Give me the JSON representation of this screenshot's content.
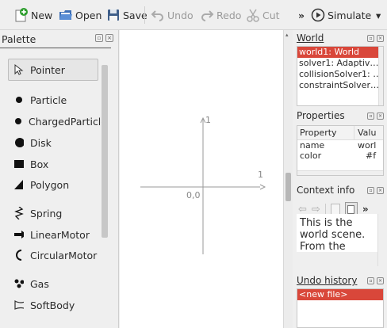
{
  "toolbar": {
    "new_label": "New",
    "open_label": "Open",
    "save_label": "Save",
    "undo_label": "Undo",
    "redo_label": "Redo",
    "cut_label": "Cut",
    "more_label": "»",
    "simulate_label": "Simulate",
    "dropdown_label": "▾"
  },
  "palette": {
    "title": "Palette",
    "items": [
      {
        "label": "Pointer",
        "icon": "pointer-arrow-icon"
      },
      {
        "label": "Particle",
        "icon": "small-dot-icon"
      },
      {
        "label": "ChargedParticle",
        "icon": "small-dot-icon"
      },
      {
        "label": "Disk",
        "icon": "disk-icon"
      },
      {
        "label": "Box",
        "icon": "box-icon"
      },
      {
        "label": "Polygon",
        "icon": "polygon-icon"
      },
      {
        "label": "Spring",
        "icon": "spring-icon"
      },
      {
        "label": "LinearMotor",
        "icon": "linear-motor-icon"
      },
      {
        "label": "CircularMotor",
        "icon": "circular-motor-icon"
      },
      {
        "label": "Gas",
        "icon": "gas-icon"
      },
      {
        "label": "SoftBody",
        "icon": "softbody-icon"
      }
    ]
  },
  "canvas": {
    "axis_y_label": "1",
    "axis_x_label": "1",
    "origin_label": "0,0"
  },
  "world": {
    "title": "World",
    "items": [
      "world1: World",
      "solver1: Adaptiv…",
      "collisionSolver1: …",
      "constraintSolver…"
    ],
    "selected_index": 0
  },
  "properties": {
    "title": "Properties",
    "col_property": "Property",
    "col_value": "Valu",
    "rows": [
      {
        "name": "name",
        "value": "worl"
      },
      {
        "name": "color",
        "value": "#f"
      }
    ]
  },
  "context_info": {
    "title": "Context info",
    "text_lines": [
      "This is the",
      "world scene.",
      "From the"
    ],
    "more_label": "»"
  },
  "undo_history": {
    "title": "Undo history",
    "items": [
      "<new file>"
    ]
  },
  "colors": {
    "selection": "#d9473a",
    "new_icon_green": "#2e9e2e",
    "folder_blue": "#3d6fb6"
  }
}
